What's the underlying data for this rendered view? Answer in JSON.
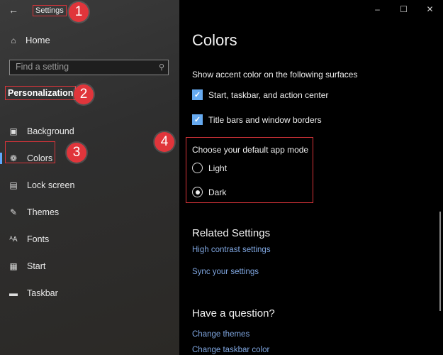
{
  "window": {
    "app_title": "Settings",
    "controls": {
      "minimize": "–",
      "maximize": "☐",
      "close": "✕"
    }
  },
  "annotations": {
    "b1": "1",
    "b2": "2",
    "b3": "3",
    "b4": "4",
    "color": "#e0353b"
  },
  "sidebar": {
    "home_label": "Home",
    "search_placeholder": "Find a setting",
    "section_label": "Personalization",
    "items": [
      {
        "label": "Background",
        "icon": "image-icon"
      },
      {
        "label": "Colors",
        "icon": "palette-icon",
        "selected": true
      },
      {
        "label": "Lock screen",
        "icon": "lock-screen-icon"
      },
      {
        "label": "Themes",
        "icon": "themes-icon"
      },
      {
        "label": "Fonts",
        "icon": "fonts-icon"
      },
      {
        "label": "Start",
        "icon": "start-icon"
      },
      {
        "label": "Taskbar",
        "icon": "taskbar-icon"
      }
    ]
  },
  "main": {
    "title": "Colors",
    "accent_heading": "Show accent color on the following surfaces",
    "checkboxes": [
      {
        "label": "Start, taskbar, and action center",
        "checked": true
      },
      {
        "label": "Title bars and window borders",
        "checked": true
      }
    ],
    "app_mode": {
      "title": "Choose your default app mode",
      "options": [
        {
          "label": "Light",
          "selected": false
        },
        {
          "label": "Dark",
          "selected": true
        }
      ]
    },
    "related": {
      "heading": "Related Settings",
      "links": [
        "High contrast settings",
        "Sync your settings"
      ]
    },
    "question": {
      "heading": "Have a question?",
      "links": [
        "Change themes",
        "Change taskbar color"
      ]
    }
  },
  "colors": {
    "accent": "#66aaf0",
    "link": "#7fa6e0",
    "highlight": "#d9343a"
  }
}
